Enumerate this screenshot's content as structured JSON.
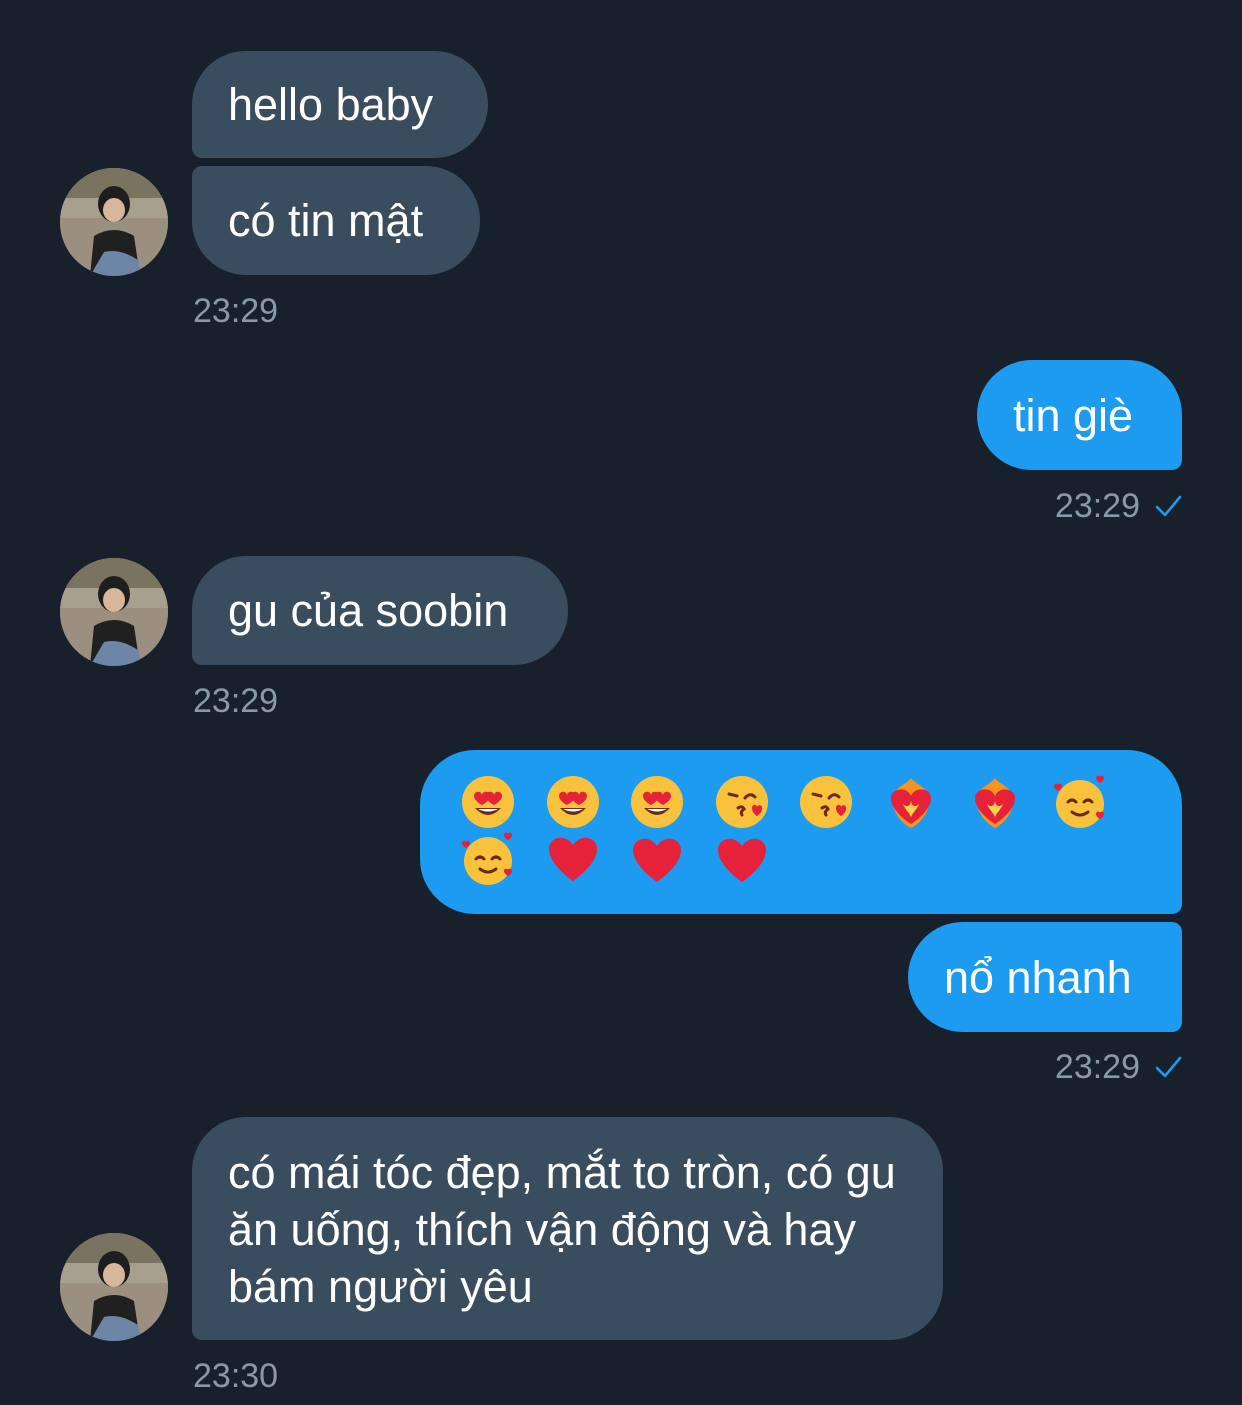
{
  "messages": [
    {
      "side": "incoming",
      "text": "hello baby"
    },
    {
      "side": "incoming",
      "text": "có tin mật"
    },
    {
      "side": "incoming_time",
      "text": "23:29"
    },
    {
      "side": "outgoing",
      "text": "tin giè"
    },
    {
      "side": "outgoing_time",
      "text": "23:29"
    },
    {
      "side": "incoming",
      "text": "gu của soobin"
    },
    {
      "side": "incoming_time",
      "text": "23:29"
    },
    {
      "side": "outgoing_emoji",
      "emoji": [
        "heart-eyes",
        "heart-eyes",
        "heart-eyes",
        "kissing-heart",
        "kissing-heart",
        "heart-on-fire",
        "heart-on-fire",
        "smiling-hearts",
        "smiling-hearts",
        "red-heart",
        "red-heart",
        "red-heart"
      ]
    },
    {
      "side": "outgoing",
      "text": "nổ nhanh"
    },
    {
      "side": "outgoing_time",
      "text": "23:29"
    },
    {
      "side": "incoming",
      "text": "có mái tóc đẹp, mắt to tròn, có gu ăn uống, thích vận động và hay bám người yêu"
    },
    {
      "side": "incoming_time",
      "text": "23:30"
    }
  ],
  "colors": {
    "background": "#17202b",
    "incoming_bubble": "#3a4d5f",
    "outgoing_bubble": "#1d9bf0",
    "timestamp": "#8a99a8",
    "read_check": "#1d9bf0"
  }
}
